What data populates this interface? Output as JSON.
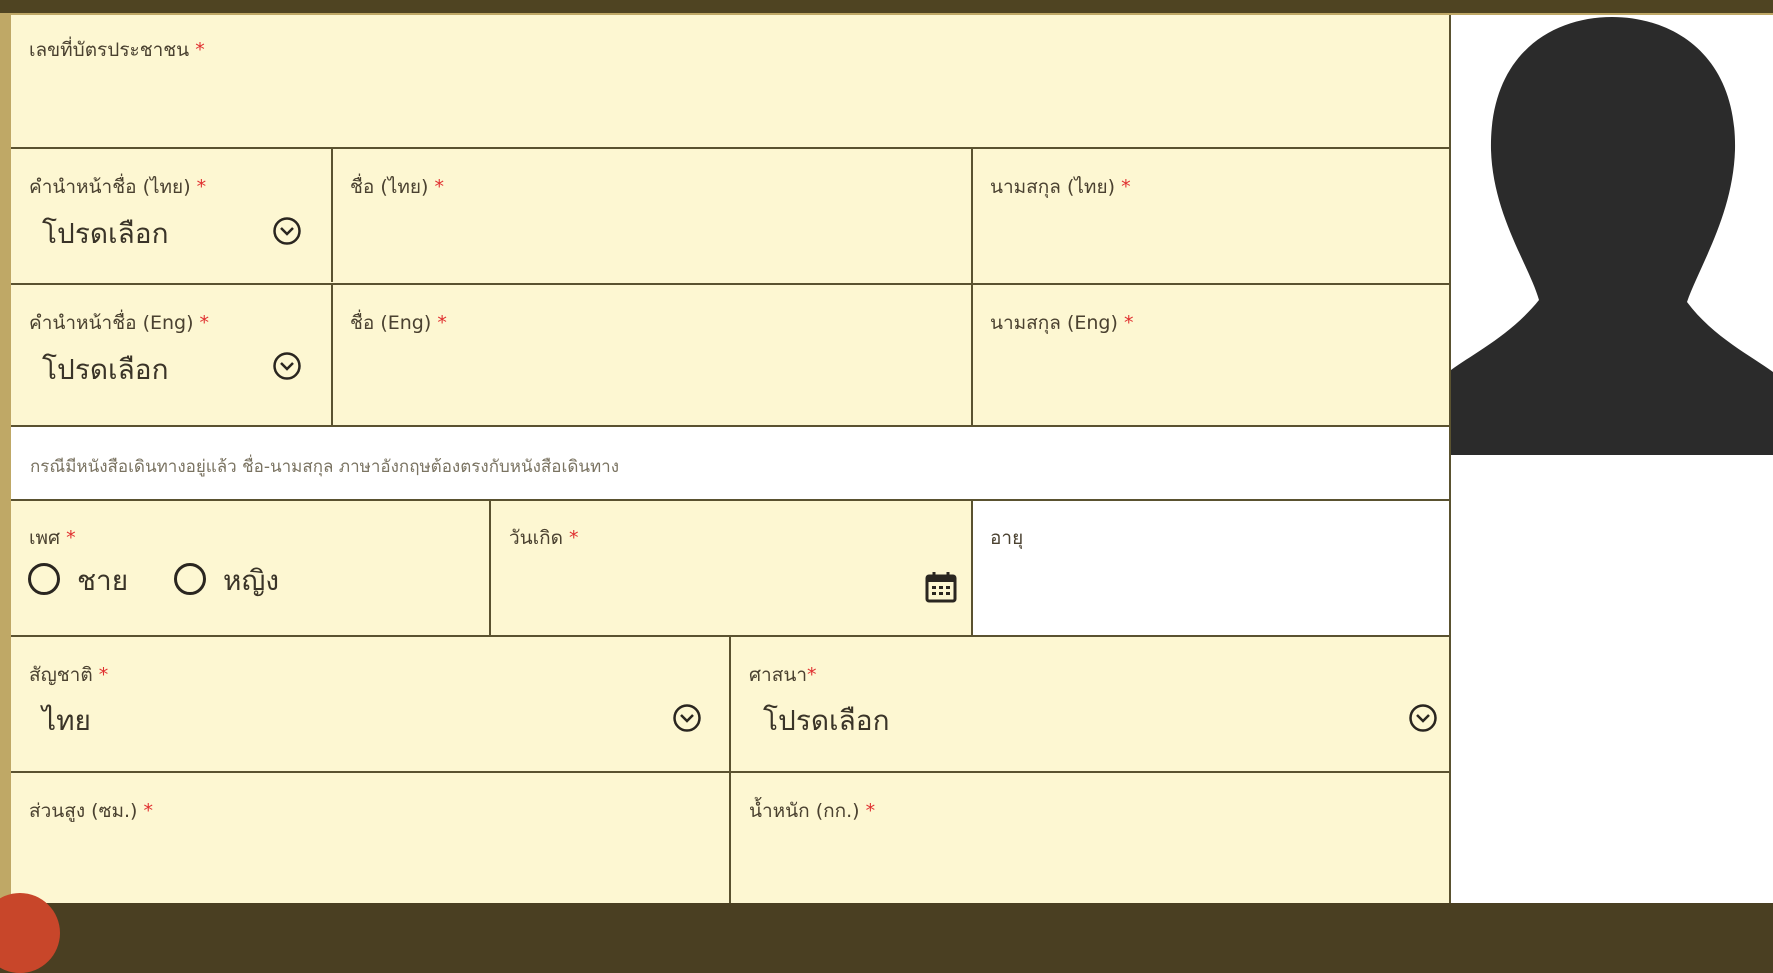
{
  "form": {
    "id_card_label": "เลขที่บัตรประชาชน",
    "title_th_label": "คำนำหน้าชื่อ (ไทย)",
    "title_th_value": "โปรดเลือก",
    "firstname_th_label": "ชื่อ (ไทย)",
    "lastname_th_label": "นามสกุล (ไทย)",
    "title_en_label": "คำนำหน้าชื่อ (Eng)",
    "title_en_value": "โปรดเลือก",
    "firstname_en_label": "ชื่อ (Eng)",
    "lastname_en_label": "นามสกุล (Eng)",
    "passport_note": "กรณีมีหนังสือเดินทางอยู่แล้ว ชื่อ-นามสกุล ภาษาอังกฤษต้องตรงกับหนังสือเดินทาง",
    "gender_label": "เพศ",
    "gender_male": "ชาย",
    "gender_female": "หญิง",
    "birthdate_label": "วันเกิด",
    "age_label": "อายุ",
    "nationality_label": "สัญชาติ",
    "nationality_value": "ไทย",
    "religion_label": "ศาสนา",
    "religion_value": "โปรดเลือก",
    "height_label": "ส่วนสูง (ซม.)",
    "weight_label": "น้ำหนัก (กก.)",
    "required_mark": "*"
  },
  "icons": {
    "dropdown": "chevron-down-circle-icon",
    "calendar": "calendar-icon",
    "avatar": "person-silhouette-icon"
  },
  "colors": {
    "field_bg": "#fdf7d2",
    "border": "#5a5230",
    "required": "#e03030",
    "frame": "#bfa866"
  }
}
